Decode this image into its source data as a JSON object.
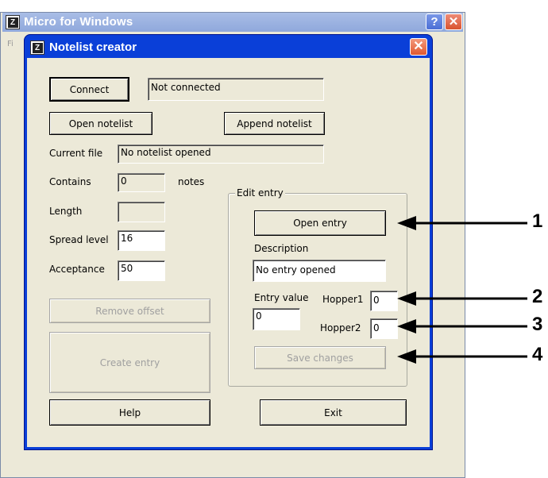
{
  "background_window": {
    "title": "Micro for Windows",
    "menu_partial": "Fi"
  },
  "dialog": {
    "title": "Notelist creator",
    "connect_label": "Connect",
    "connection_status": "Not connected",
    "open_notelist_label": "Open notelist",
    "append_notelist_label": "Append notelist",
    "current_file_label": "Current file",
    "current_file_value": "No notelist opened",
    "contains_label": "Contains",
    "contains_value": "0",
    "notes_label": "notes",
    "length_label": "Length",
    "length_value": "",
    "spread_level_label": "Spread level",
    "spread_level_value": "16",
    "acceptance_label": "Acceptance",
    "acceptance_value": "50",
    "remove_offset_label": "Remove offset",
    "create_entry_label": "Create entry",
    "help_label": "Help",
    "exit_label": "Exit"
  },
  "edit_entry": {
    "group_label": "Edit entry",
    "open_entry_label": "Open entry",
    "description_label": "Description",
    "description_value": "No entry opened",
    "entry_value_label": "Entry value",
    "entry_value": "0",
    "hopper1_label": "Hopper1",
    "hopper1_value": "0",
    "hopper2_label": "Hopper2",
    "hopper2_value": "0",
    "save_changes_label": "Save changes"
  },
  "callouts": [
    "1",
    "2",
    "3",
    "4"
  ],
  "colors": {
    "dialog_titlebar": "#0a3fd8",
    "face": "#ece9d8",
    "close_button": "#e0582f"
  }
}
